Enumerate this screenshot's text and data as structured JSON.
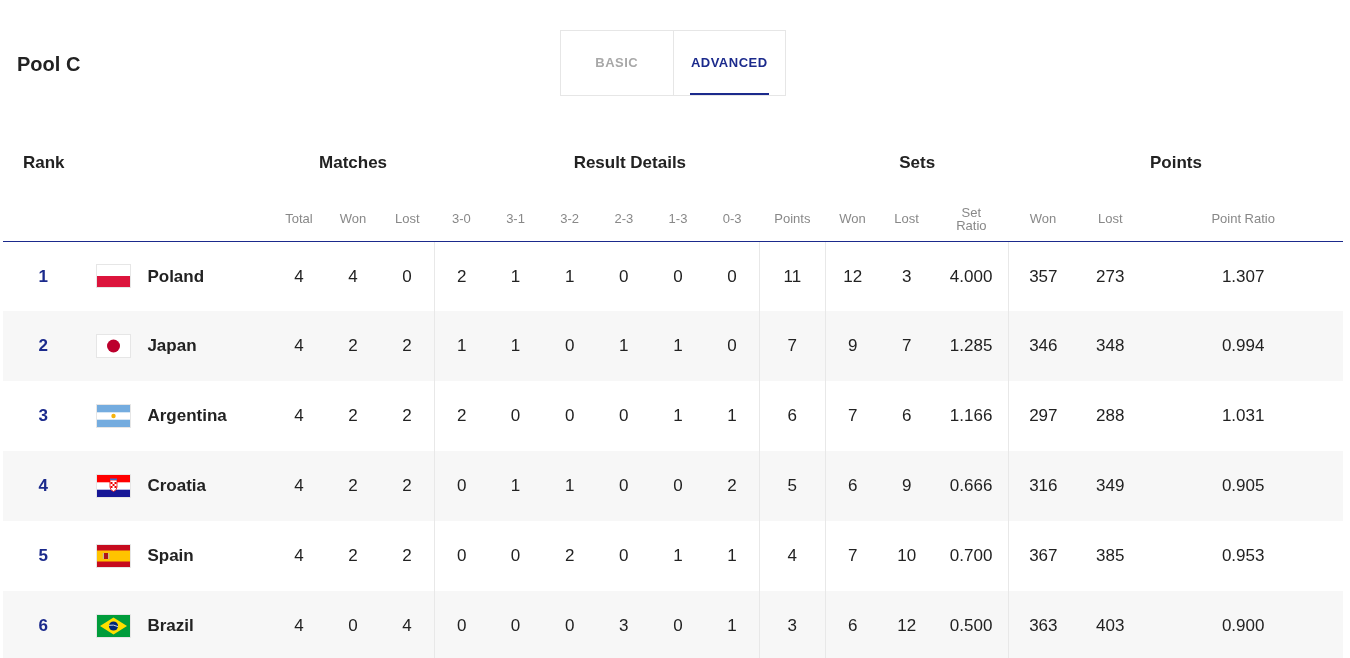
{
  "title": "Pool C",
  "tabs": [
    {
      "label": "BASIC",
      "selected": false
    },
    {
      "label": "ADVANCED",
      "selected": true
    }
  ],
  "table": {
    "group_headers": [
      "Rank",
      "Matches",
      "Result Details",
      "Sets",
      "Points"
    ],
    "columns": [
      "Total",
      "Won",
      "Lost",
      "3-0",
      "3-1",
      "3-2",
      "2-3",
      "1-3",
      "0-3",
      "Points",
      "Won",
      "Lost",
      "Set Ratio",
      "Won",
      "Lost",
      "Point Ratio"
    ],
    "rows": [
      {
        "rank": "1",
        "kind": "poland",
        "team": "Poland",
        "cells": [
          "4",
          "4",
          "0",
          "2",
          "1",
          "1",
          "0",
          "0",
          "0",
          "11",
          "12",
          "3",
          "4.000",
          "357",
          "273",
          "1.307"
        ]
      },
      {
        "rank": "2",
        "kind": "japan",
        "team": "Japan",
        "cells": [
          "4",
          "2",
          "2",
          "1",
          "1",
          "0",
          "1",
          "1",
          "0",
          "7",
          "9",
          "7",
          "1.285",
          "346",
          "348",
          "0.994"
        ]
      },
      {
        "rank": "3",
        "kind": "argentina",
        "team": "Argentina",
        "cells": [
          "4",
          "2",
          "2",
          "2",
          "0",
          "0",
          "0",
          "1",
          "1",
          "6",
          "7",
          "6",
          "1.166",
          "297",
          "288",
          "1.031"
        ]
      },
      {
        "rank": "4",
        "kind": "croatia",
        "team": "Croatia",
        "cells": [
          "4",
          "2",
          "2",
          "0",
          "1",
          "1",
          "0",
          "0",
          "2",
          "5",
          "6",
          "9",
          "0.666",
          "316",
          "349",
          "0.905"
        ]
      },
      {
        "rank": "5",
        "kind": "spain",
        "team": "Spain",
        "cells": [
          "4",
          "2",
          "2",
          "0",
          "0",
          "2",
          "0",
          "1",
          "1",
          "4",
          "7",
          "10",
          "0.700",
          "367",
          "385",
          "0.953"
        ]
      },
      {
        "rank": "6",
        "kind": "brazil",
        "team": "Brazil",
        "cells": [
          "4",
          "0",
          "4",
          "0",
          "0",
          "0",
          "3",
          "0",
          "1",
          "3",
          "6",
          "12",
          "0.500",
          "363",
          "403",
          "0.900"
        ]
      }
    ]
  }
}
